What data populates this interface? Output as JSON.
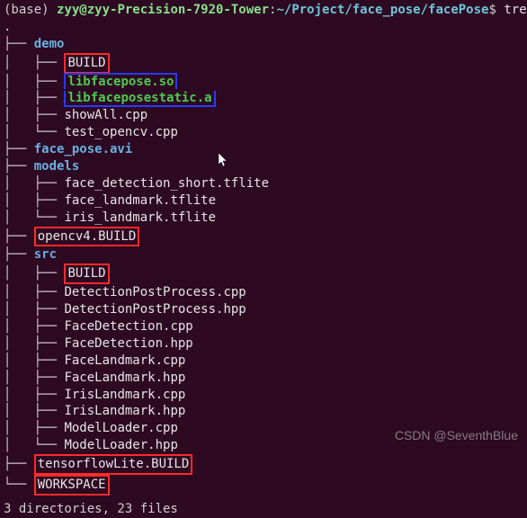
{
  "prompt": {
    "env": "(base) ",
    "user": "zyy@zyy-Precision-7920-Tower",
    "colon": ":",
    "path": "~/Project/face_pose/facePose",
    "dollar": "$",
    "cmd": " tree"
  },
  "lines": [
    {
      "branch": ".",
      "cls": "file",
      "text": ""
    },
    {
      "branch": "├── ",
      "cls": "dir",
      "text": "demo"
    },
    {
      "branch": "│   ├── ",
      "cls": "file",
      "text": "BUILD",
      "box": "red"
    },
    {
      "branch": "│   ├── ",
      "cls": "lib",
      "text": "libfacepose.so",
      "box": "blue",
      "boxStart": true
    },
    {
      "branch": "│   ├── ",
      "cls": "lib",
      "text": "libfaceposestatic.a",
      "box": "blue",
      "boxEnd": true
    },
    {
      "branch": "│   ├── ",
      "cls": "file",
      "text": "showAll.cpp"
    },
    {
      "branch": "│   └── ",
      "cls": "file",
      "text": "test_opencv.cpp"
    },
    {
      "branch": "├── ",
      "cls": "dir",
      "text": "face_pose.avi"
    },
    {
      "branch": "├── ",
      "cls": "dir",
      "text": "models"
    },
    {
      "branch": "│   ├── ",
      "cls": "file",
      "text": "face_detection_short.tflite"
    },
    {
      "branch": "│   ├── ",
      "cls": "file",
      "text": "face_landmark.tflite"
    },
    {
      "branch": "│   └── ",
      "cls": "file",
      "text": "iris_landmark.tflite"
    },
    {
      "branch": "├── ",
      "cls": "file",
      "text": "opencv4.BUILD",
      "box": "red"
    },
    {
      "branch": "├── ",
      "cls": "dir",
      "text": "src"
    },
    {
      "branch": "│   ├── ",
      "cls": "file",
      "text": "BUILD",
      "box": "red"
    },
    {
      "branch": "│   ├── ",
      "cls": "file",
      "text": "DetectionPostProcess.cpp"
    },
    {
      "branch": "│   ├── ",
      "cls": "file",
      "text": "DetectionPostProcess.hpp"
    },
    {
      "branch": "│   ├── ",
      "cls": "file",
      "text": "FaceDetection.cpp"
    },
    {
      "branch": "│   ├── ",
      "cls": "file",
      "text": "FaceDetection.hpp"
    },
    {
      "branch": "│   ├── ",
      "cls": "file",
      "text": "FaceLandmark.cpp"
    },
    {
      "branch": "│   ├── ",
      "cls": "file",
      "text": "FaceLandmark.hpp"
    },
    {
      "branch": "│   ├── ",
      "cls": "file",
      "text": "IrisLandmark.cpp"
    },
    {
      "branch": "│   ├── ",
      "cls": "file",
      "text": "IrisLandmark.hpp"
    },
    {
      "branch": "│   ├── ",
      "cls": "file",
      "text": "ModelLoader.cpp"
    },
    {
      "branch": "│   └── ",
      "cls": "file",
      "text": "ModelLoader.hpp"
    },
    {
      "branch": "├── ",
      "cls": "file",
      "text": "tensorflowLite.BUILD",
      "box": "red"
    },
    {
      "branch": "└── ",
      "cls": "file",
      "text": "WORKSPACE",
      "box": "red"
    }
  ],
  "summary": "3 directories, 23 files",
  "watermark": "CSDN @SeventhBlue"
}
